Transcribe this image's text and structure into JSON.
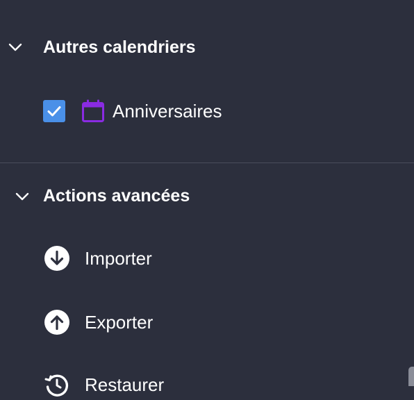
{
  "sections": {
    "other_calendars": {
      "title": "Autres calendriers",
      "items": [
        {
          "label": "Anniversaires",
          "checked": true,
          "icon": "calendar-icon",
          "color": "#8a2be2"
        }
      ]
    },
    "advanced_actions": {
      "title": "Actions avancées",
      "items": [
        {
          "label": "Importer",
          "icon": "download-circle-icon"
        },
        {
          "label": "Exporter",
          "icon": "upload-circle-icon"
        },
        {
          "label": "Restaurer",
          "icon": "history-icon"
        }
      ]
    }
  },
  "colors": {
    "background": "#2c2f3d",
    "checkbox": "#4a90e8",
    "calendar_accent": "#8a2be2",
    "divider": "#4a4d5c"
  }
}
